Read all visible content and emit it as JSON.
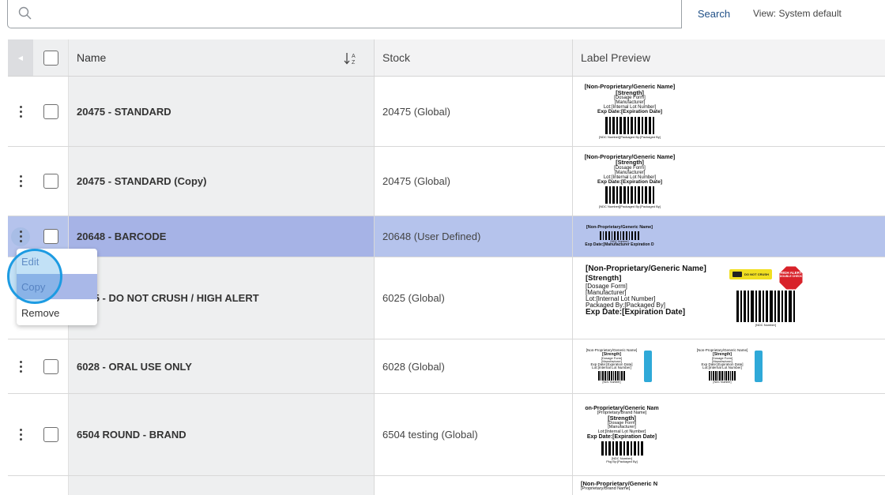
{
  "search": {
    "placeholder": "",
    "value": "",
    "button_label": "Search"
  },
  "view_label": "View: System default",
  "table": {
    "columns": [
      "Name",
      "Stock",
      "Label Preview"
    ],
    "rows": [
      {
        "name": "20475 - STANDARD",
        "stock": "20475 (Global)",
        "selected": false
      },
      {
        "name": "20475 - STANDARD (Copy)",
        "stock": "20475 (Global)",
        "selected": false
      },
      {
        "name": "20648 - BARCODE",
        "stock": "20648 (User Defined)",
        "selected": true
      },
      {
        "name": "6025 - DO NOT CRUSH / HIGH ALERT",
        "stock": "6025 (Global)",
        "selected": false
      },
      {
        "name": "6028 - ORAL USE ONLY",
        "stock": "6028 (Global)",
        "selected": false
      },
      {
        "name": "6504 ROUND - BRAND",
        "stock": "6504 testing (Global)",
        "selected": false
      }
    ]
  },
  "label_text": {
    "generic_name": "[Non-Proprietary/Generic Name]",
    "strength": "[Strength]",
    "dosage_form": "[Dosage Form]",
    "manufacturer": "[Manufacturer]",
    "lot": "Lot:[Internal Lot Number]",
    "exp": "Exp Date:[Expiration Date]",
    "ndc": "[NDC Number]",
    "packaged_by": "Packaged By:[Packaged By]",
    "ndc_packaged_small": "[NDC Number][Packaged By:[Packaged By]",
    "barcode_exp": "Exp Date:[Manufacturer Expiration D",
    "do_not_crush": "DO NOT CRUSH",
    "high_alert": "HIGH ALERT",
    "double_check": "DOUBLE CHECK",
    "brand_name": "[Proprietary/Brand Name]",
    "generic_name_cut": "on-Proprietary/Generic Nam",
    "pkg_by": "Pkg By:[Packaged By]",
    "generic_name_cut2": "[Non-Proprietary/Generic N",
    "brand_name_cut": "[Proprietary/Brand Name]"
  },
  "context_menu": {
    "items": [
      "Edit",
      "Copy",
      "Remove"
    ],
    "hovered": "Copy"
  },
  "colors": {
    "selected_row": "#b5c3ec",
    "accent": "#1d9be2",
    "search_button": "#1f4f86"
  }
}
